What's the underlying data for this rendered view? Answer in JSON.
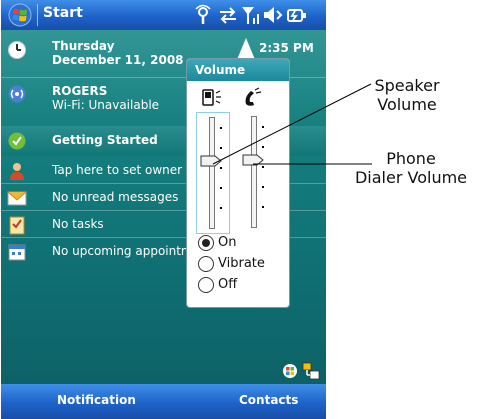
{
  "title_bar": {
    "start_label": "Start",
    "status_icons": [
      "windows-flag-icon",
      "wifi-icon",
      "sync-arrows-icon",
      "signal-icon",
      "speaker-icon",
      "battery-power-icon"
    ]
  },
  "today": {
    "date": {
      "day": "Thursday",
      "date": "December 11, 2008",
      "time": "2:35 PM"
    },
    "rogers": {
      "name": "ROGERS",
      "status": "Wi-Fi: Unavailable"
    },
    "getting_started": "Getting Started",
    "owner": "Tap here to set owner",
    "messages": "No unread messages",
    "tasks": "No tasks",
    "appointments": "No upcoming appointm"
  },
  "volume_popup": {
    "title": "Volume",
    "speaker_level_fraction": 0.6,
    "phone_level_fraction": 0.6,
    "ringer_options": [
      "On",
      "Vibrate",
      "Off"
    ],
    "selected_option": "On"
  },
  "soft_keys": {
    "left": "Notification",
    "right": "Contacts"
  },
  "callouts": {
    "speaker": [
      "Speaker",
      "Volume"
    ],
    "phone": [
      "Phone",
      "Dialer Volume"
    ]
  },
  "colors": {
    "title_bar": "#1e62c9",
    "today_background": "#137777",
    "popup_header": "#1b8a9c"
  }
}
